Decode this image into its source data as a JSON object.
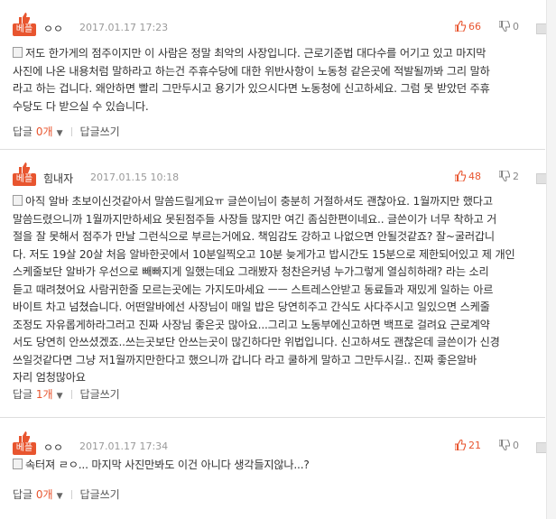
{
  "colors": {
    "accent": "#e8552f",
    "muted": "#9a9a9a",
    "divider": "#dedede"
  },
  "comments": [
    {
      "best_badge": "베플",
      "author": "ㅇㅇ",
      "date": "2017.01.17 17:23",
      "likes": "66",
      "dislikes": "0",
      "lines": [
        "저도 한가게의 점주이지만 이 사람은 정말 최악의 사장입니다. 근로기준법 대다수를 어기고 있고 마지막",
        "사진에 나온 내용처럼 말하라고 하는건 주휴수당에 대한 위반사항이 노동청 같은곳에 적발될까봐 그리 말하",
        "라고 하는 겁니다. 왜안하면 빨리 그만두시고 용기가 있으시다면 노동청에 신고하세요. 그럼 못 받았던 주휴",
        "수당도 다 받으실 수 있습니다."
      ],
      "reply_label": "답글",
      "reply_count": "0개",
      "write_reply": "답글쓰기"
    },
    {
      "best_badge": "베플",
      "author": "힘내자",
      "date": "2017.01.15 10:18",
      "likes": "48",
      "dislikes": "2",
      "lines": [
        "아직 알바 초보이신것같아서 말씀드릴게요ㅠ 글쓴이님이 충분히 거절하셔도 괜찮아요. 1월까지만 했다고",
        "말씀드렸으니까 1월까지만하세요 못된점주들 사장들 많지만 여긴 좀심한편이네요.. 글쓴이가 너무 착하고 거",
        "절을 잘 못해서 점주가 만날 그런식으로 부르는거에요. 책임감도 강하고 나없으면 안될것같죠? 잘~굴러갑니",
        "다. 저도 19살 20살 처음 알바한곳에서 10분일찍오고 10분 늦게가고 밥시간도 15분으로 제한되어있고 제 개인",
        "스케줄보단 알바가 우선으로 빼빠지게 일했는데요 그래봤자 청찬은커녕 누가그렇게 열심히하래? 라는 소리",
        "듣고 때려쳤어요 사람귀한줄 모르는곳에는 가지도마세요 ㅡㅡ 스트레스안받고 동료들과 재밌게 일하는 아르",
        "바이트 차고 넘쳤습니다. 어떤알바에선 사장님이 매일 밥은 당연히주고 간식도 사다주시고 일있으면 스케줄",
        "조정도 자유롭게하라그러고 진짜 사장님 좋은곳 많아요...그리고 노동부에신고하면 백프로 걸려요 근로계약",
        "서도 당연히 안쓰셨겠죠..쓰는곳보단 안쓰는곳이 많긴하다만 위법입니다. 신고하셔도 괜찮은데 글쓴이가 신경",
        "쓰일것같다면 그냥 저1월까지만한다고 했으니까 갑니다 라고 쿨하게 말하고 그만두시길.. 진짜 좋은알바",
        "자리 엄청많아요"
      ],
      "reply_label": "답글",
      "reply_count": "1개",
      "write_reply": "답글쓰기"
    },
    {
      "best_badge": "베플",
      "author": "ㅇㅇ",
      "date": "2017.01.17 17:34",
      "likes": "21",
      "dislikes": "0",
      "lines": [
        "속터져 ㄹㅇ... 마지막 사진만봐도 이건 아니다 생각들지않나...?"
      ],
      "reply_label": "답글",
      "reply_count": "0개",
      "write_reply": "답글쓰기"
    }
  ]
}
